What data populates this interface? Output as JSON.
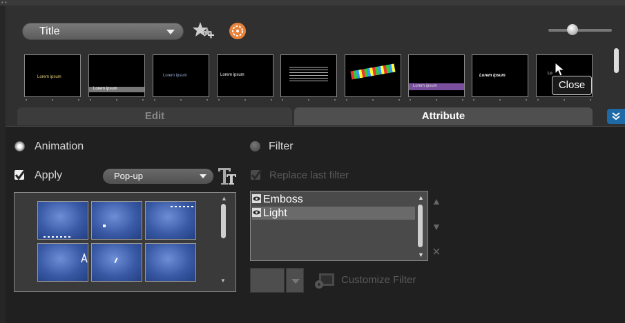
{
  "title_dropdown": {
    "value": "Title"
  },
  "slider": {
    "level": 0.38
  },
  "thumbnails": [
    {
      "text": "Lorem ipsum"
    },
    {
      "text": "Lorem ipsum"
    },
    {
      "text": "Lorem ipsum"
    },
    {
      "text": "Lorem ipsum"
    },
    {
      "text": ""
    },
    {
      "text": ""
    },
    {
      "text": "Lorem ipsum"
    },
    {
      "text": "Lorem ipsum"
    },
    {
      "text": "Lo"
    }
  ],
  "tooltip": {
    "text": "Close"
  },
  "tabs": {
    "edit": "Edit",
    "attribute": "Attribute"
  },
  "attribute": {
    "animation_label": "Animation",
    "filter_label": "Filter",
    "apply_label": "Apply",
    "animation_dropdown": "Pop-up",
    "replace_label": "Replace last filter",
    "filters": [
      "Emboss",
      "Light"
    ],
    "customize_label": "Customize Filter"
  },
  "colors": {
    "accent": "#1e6aa6",
    "selection": "#7a4fa0",
    "animation_tile": "#3a5aa6"
  }
}
